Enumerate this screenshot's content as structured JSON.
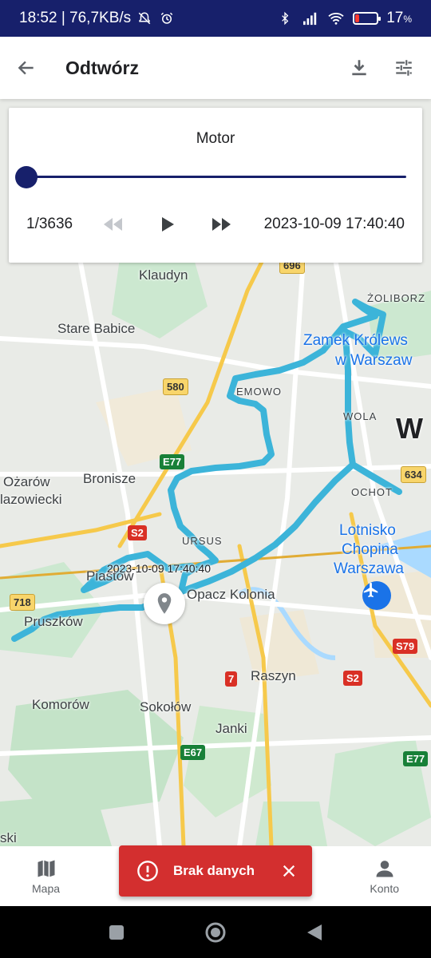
{
  "status_bar": {
    "time_speed": "18:52 | 76,7KB/s",
    "battery": "17",
    "battery_suffix": "%",
    "battery_level": 0.17
  },
  "app_bar": {
    "title": "Odtwórz",
    "icons": [
      "arrow-back-icon",
      "download-icon",
      "tune-icon"
    ]
  },
  "player": {
    "vehicle_name": "Motor",
    "counter": "1/3636",
    "timestamp": "2023-10-09 17:40:40",
    "progress": 0.0,
    "controls": [
      "rewind-icon",
      "play-icon",
      "fast-forward-icon"
    ]
  },
  "map": {
    "labels": {
      "klaudyn": "Klaudyn",
      "stare_babice": "Stare Babice",
      "zoliborz": "ŻOLIBORZ",
      "zamek": "Zamek Królews",
      "warszaw": "w Warszaw",
      "emowo": "EMOWO",
      "wola": "WOLA",
      "w_big": "W",
      "ozarow": "Ożarów",
      "mazowiecki": "lazowiecki",
      "bronisze": "Bronisze",
      "ochota": "OCHOT",
      "lotnisko": "Lotnisko",
      "chopina": "Chopina",
      "warszawa": "Warszawa",
      "ursus": "URSUS",
      "piastow": "Piastow",
      "pruszkow": "Pruszków",
      "opacz": "Opacz Kolonia",
      "raszyn": "Raszyn",
      "komorow": "Komorów",
      "sokolow": "Sokołów",
      "janki": "Janki",
      "ski": "ski"
    },
    "shields": {
      "r580": "580",
      "e77a": "E77",
      "s2a": "S2",
      "r718": "718",
      "r634": "634",
      "s79": "S79",
      "r7": "7",
      "s2b": "S2",
      "e67": "E67",
      "e77b": "E77",
      "r696": "696"
    },
    "marker_time": "2023-10-09 17:40:40",
    "route_color": "#3cb4d9"
  },
  "bottom_nav": {
    "map_label": "Mapa",
    "account_label": "Konto"
  },
  "toast": {
    "message": "Brak danych",
    "color": "#d32f2f"
  }
}
